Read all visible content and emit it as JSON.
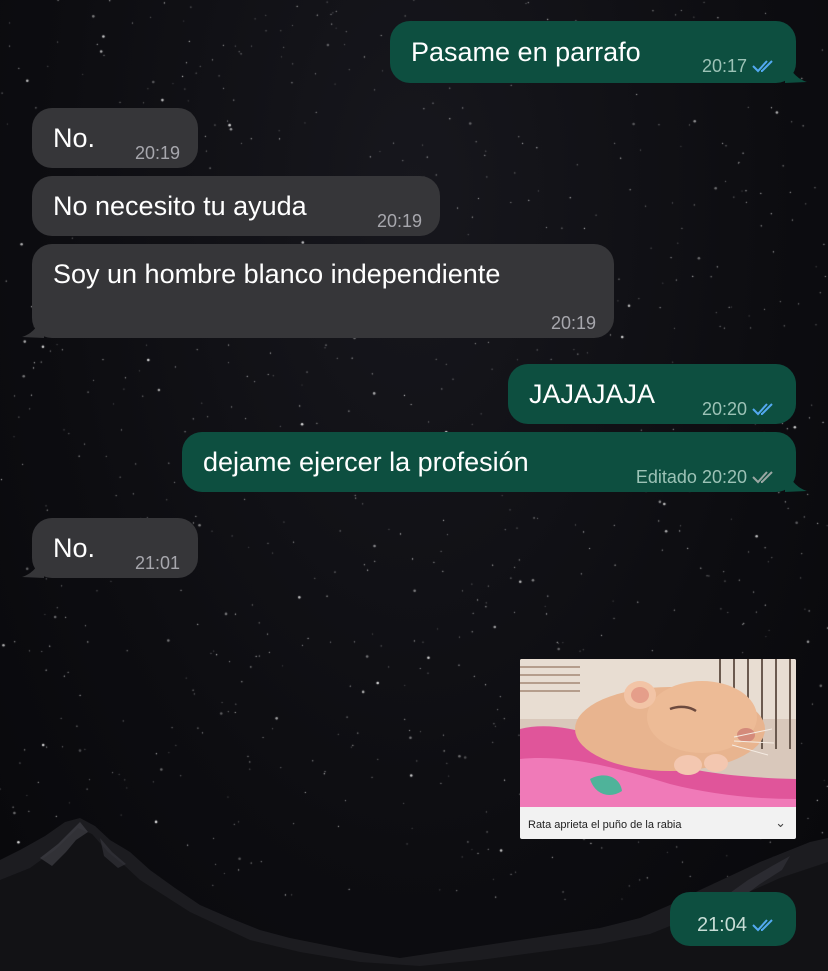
{
  "colors": {
    "incoming_bubble": "#363639",
    "outgoing_bubble": "#0d4f40",
    "read_ticks": "#53a9f1",
    "sent_ticks": "#9aa7a3"
  },
  "messages": [
    {
      "direction": "outgoing",
      "text": "Pasame en parrafo",
      "time": "20:17",
      "status": "read"
    },
    {
      "direction": "incoming",
      "text": "No.",
      "time": "20:19"
    },
    {
      "direction": "incoming",
      "text": "No necesito tu ayuda",
      "time": "20:19"
    },
    {
      "direction": "incoming",
      "text": "Soy un hombre blanco independiente",
      "time": "20:19"
    },
    {
      "direction": "outgoing",
      "text": "JAJAJAJA",
      "time": "20:20",
      "status": "read"
    },
    {
      "direction": "outgoing",
      "text": "dejame ejercer la profesión",
      "edited_label": "Editado",
      "time": "20:20",
      "status": "delivered"
    },
    {
      "direction": "incoming",
      "text": "No.",
      "time": "21:01"
    },
    {
      "direction": "outgoing",
      "type": "link-preview",
      "caption": "Rata aprieta el puño de la rabia",
      "icon": "chevron-down-icon"
    },
    {
      "direction": "outgoing",
      "text": "",
      "time": "21:04",
      "status": "read"
    }
  ]
}
